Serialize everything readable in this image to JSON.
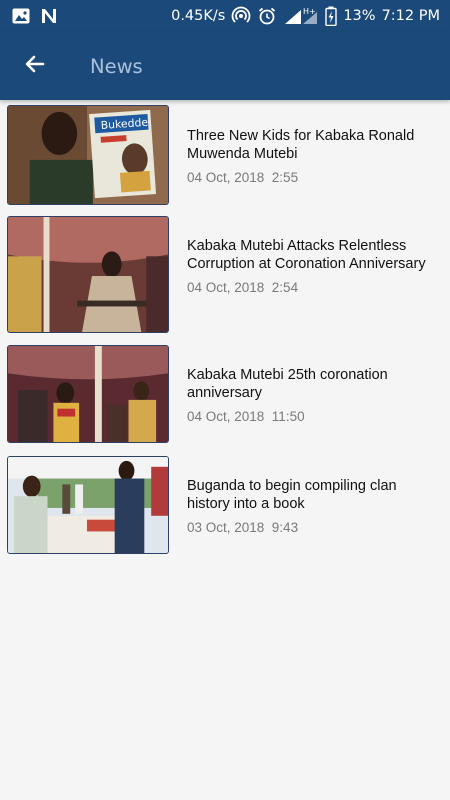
{
  "status_bar": {
    "network_speed": "0.45K/s",
    "battery": "13%",
    "time": "7:12 PM",
    "network_type": "H+",
    "icons": [
      "image-icon",
      "n-app-icon",
      "hotspot-icon",
      "alarm-icon",
      "signal-icon",
      "battery-charging-icon"
    ]
  },
  "app_bar": {
    "title": "News",
    "back_icon": "arrow-left-icon",
    "background": "#1b4a7a",
    "title_color": "#a9c1dc"
  },
  "news": [
    {
      "title": "Three New Kids for Kabaka Ronald Muwenda Mutebi",
      "date": "04 Oct, 2018  2:55",
      "thumb_text": "Bukedde"
    },
    {
      "title": "Kabaka Mutebi Attacks Relentless Corruption at Coronation Anniversary",
      "date": "04 Oct, 2018  2:54"
    },
    {
      "title": "Kabaka Mutebi 25th coronation anniversary",
      "date": "04 Oct, 2018  11:50"
    },
    {
      "title": "Buganda to begin compiling clan history into a book",
      "date": "03 Oct, 2018  9:43"
    }
  ]
}
